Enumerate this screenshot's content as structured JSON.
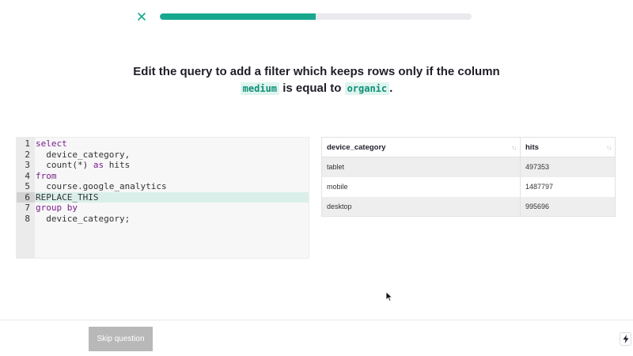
{
  "header": {
    "close_icon": "close-icon",
    "progress_fraction": 0.5
  },
  "question": {
    "prefix": "Edit the query to add a filter which keeps rows only if the column",
    "column_name": "medium",
    "middle": "is equal to",
    "value": "organic",
    "suffix": "."
  },
  "editor": {
    "lines": [
      {
        "num": "1",
        "text": "select"
      },
      {
        "num": "2",
        "text": "  device_category,"
      },
      {
        "num": "3",
        "text": "  count(*) as hits"
      },
      {
        "num": "4",
        "text": "from"
      },
      {
        "num": "5",
        "text": "  course.google_analytics"
      },
      {
        "num": "6",
        "text": "REPLACE_THIS"
      },
      {
        "num": "7",
        "text": "group by"
      },
      {
        "num": "8",
        "text": "  device_category;"
      }
    ],
    "active_line": 6
  },
  "results": {
    "columns": [
      "device_category",
      "hits"
    ],
    "sort_icon": "sort-arrows-icon",
    "rows": [
      [
        "tablet",
        "497353"
      ],
      [
        "mobile",
        "1487797"
      ],
      [
        "desktop",
        "995696"
      ]
    ]
  },
  "footer": {
    "skip_label": "Skip question",
    "bolt_icon": "lightning-icon"
  },
  "colors": {
    "accent": "#17a88e",
    "code_highlight_bg": "#dff4ef",
    "keyword": "#7a1e8c"
  }
}
